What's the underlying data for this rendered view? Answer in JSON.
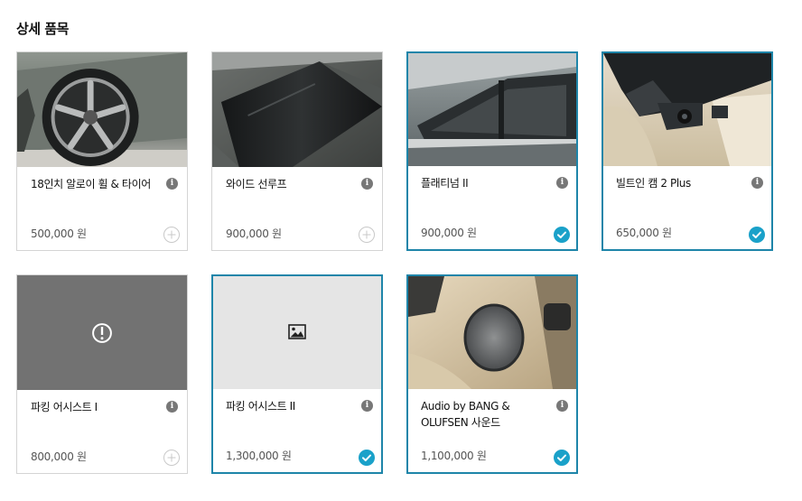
{
  "section": {
    "title": "상세 품목"
  },
  "items": [
    {
      "name": "18인치 알로이 휠 & 타이어",
      "price": "500,000 원",
      "selected": false,
      "image": "alloy-wheel-image"
    },
    {
      "name": "와이드 선루프",
      "price": "900,000 원",
      "selected": false,
      "image": "sunroof-image"
    },
    {
      "name": "플래티넘 II",
      "price": "900,000 원",
      "selected": true,
      "image": "platinum-image"
    },
    {
      "name": "빌트인 캠 2 Plus",
      "price": "650,000 원",
      "selected": true,
      "image": "builtin-cam-image"
    },
    {
      "name": "파킹 어시스트 I",
      "price": "800,000 원",
      "selected": false,
      "image": "error-placeholder-image"
    },
    {
      "name": "파킹 어시스트 II",
      "price": "1,300,000 원",
      "selected": true,
      "image": "image-placeholder"
    },
    {
      "name": "Audio by BANG & OLUFSEN 사운드",
      "price": "1,100,000 원",
      "selected": true,
      "image": "speaker-image"
    }
  ],
  "icons": {
    "info": "info-icon",
    "add": "plus-circle-icon",
    "selected": "check-circle-icon"
  },
  "colors": {
    "selected_border": "#1e85a9",
    "check_fill": "#1aa1c9",
    "default_border": "#d4d4d4"
  },
  "info_glyph": "i"
}
